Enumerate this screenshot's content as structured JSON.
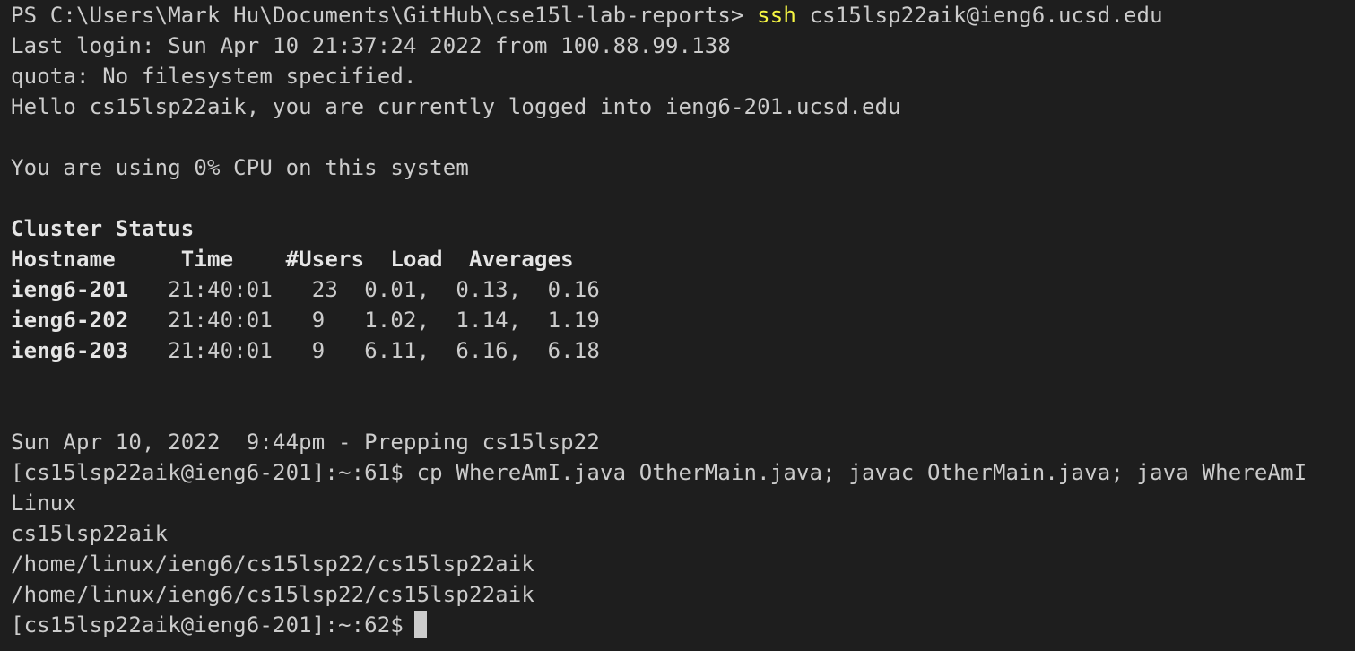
{
  "terminal": {
    "prompt_ps": "PS C:\\Users\\Mark Hu\\Documents\\GitHub\\cse15l-lab-reports> ",
    "ssh_cmd": "ssh",
    "ssh_args": " cs15lsp22aik@ieng6.ucsd.edu",
    "last_login": "Last login: Sun Apr 10 21:37:24 2022 from 100.88.99.138",
    "quota": "quota: No filesystem specified.",
    "hello": "Hello cs15lsp22aik, you are currently logged into ieng6-201.ucsd.edu",
    "cpu": "You are using 0% CPU on this system",
    "cluster_status": "Cluster Status",
    "cluster_header": "Hostname     Time    #Users  Load  Averages",
    "rows": [
      {
        "host": "ieng6-201",
        "rest": "   21:40:01   23  0.01,  0.13,  0.16"
      },
      {
        "host": "ieng6-202",
        "rest": "   21:40:01   9   1.02,  1.14,  1.19"
      },
      {
        "host": "ieng6-203",
        "rest": "   21:40:01   9   6.11,  6.16,  6.18"
      }
    ],
    "date_line": "Sun Apr 10, 2022  9:44pm - Prepping cs15lsp22",
    "prompt1": "[cs15lsp22aik@ieng6-201]:~:61$ cp WhereAmI.java OtherMain.java; javac OtherMain.java; java WhereAmI",
    "out_os": "Linux",
    "out_user": "cs15lsp22aik",
    "out_home": "/home/linux/ieng6/cs15lsp22/cs15lsp22aik",
    "out_dir": "/home/linux/ieng6/cs15lsp22/cs15lsp22aik",
    "prompt2": "[cs15lsp22aik@ieng6-201]:~:62$"
  },
  "colors": {
    "background": "#1e1e1e",
    "foreground": "#cccccc",
    "command_highlight": "#f5f543"
  }
}
